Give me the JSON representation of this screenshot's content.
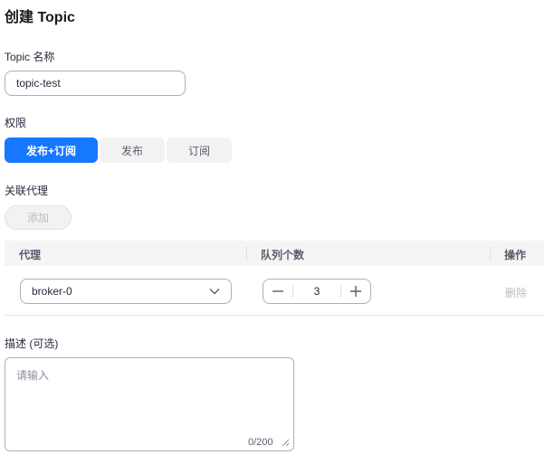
{
  "page": {
    "title": "创建 Topic"
  },
  "topic_name": {
    "label": "Topic 名称",
    "value": "topic-test"
  },
  "permission": {
    "label": "权限",
    "options": [
      {
        "label": "发布+订阅",
        "selected": true
      },
      {
        "label": "发布",
        "selected": false
      },
      {
        "label": "订阅",
        "selected": false
      }
    ]
  },
  "brokers": {
    "label": "关联代理",
    "add_label": "添加",
    "columns": [
      "代理",
      "队列个数",
      "操作"
    ],
    "rows": [
      {
        "broker": "broker-0",
        "queue_count": "3",
        "action": "删除"
      }
    ]
  },
  "description": {
    "label": "描述 (可选)",
    "placeholder": "请输入",
    "counter": "0/200"
  },
  "colors": {
    "accent": "#1677ff",
    "border": "#adb0b8",
    "disabled_text": "#b8bcc4"
  },
  "icons": {
    "select": "chevron-down-icon",
    "decrement": "minus-icon",
    "increment": "plus-icon",
    "resize": "resize-handle-icon"
  }
}
